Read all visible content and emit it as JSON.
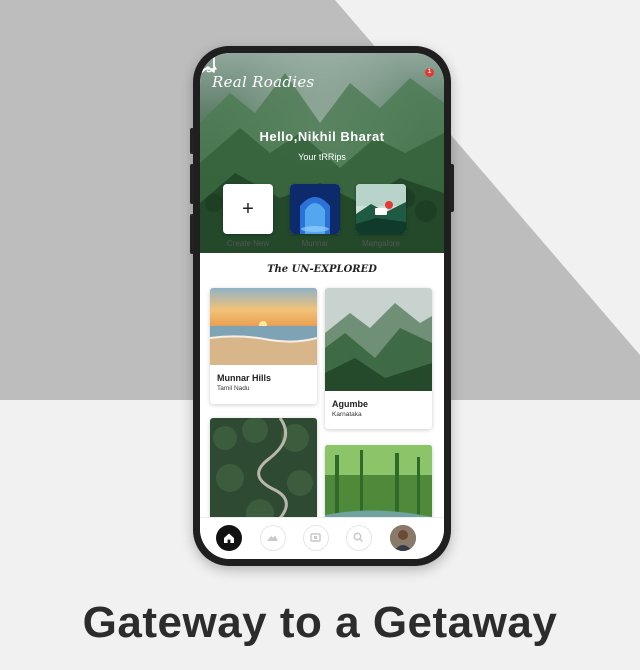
{
  "app": {
    "brand": "Real Roadies",
    "notification_count": "1"
  },
  "header": {
    "greeting": "Hello,Nikhil Bharat",
    "subtitle": "Your tRRips"
  },
  "trips": [
    {
      "label": "Create New",
      "icon": "plus-icon"
    },
    {
      "label": "Munnar"
    },
    {
      "label": "Mangalore"
    }
  ],
  "section": {
    "title": "The UN-EXPLORED"
  },
  "places": [
    {
      "name": "Munnar Hills",
      "region": "Tamil Nadu"
    },
    {
      "name": "Agumbe",
      "region": "Karnataka"
    }
  ],
  "nav": {
    "items": [
      "home-icon",
      "mountain-icon",
      "ticket-icon",
      "search-icon",
      "profile-avatar"
    ]
  },
  "tagline": "Gateway to a Getaway",
  "colors": {
    "background": "#f1f1f1",
    "accent_shape": "#bdbdbd",
    "phone": "#1f1f1f",
    "badge": "#e53935"
  }
}
